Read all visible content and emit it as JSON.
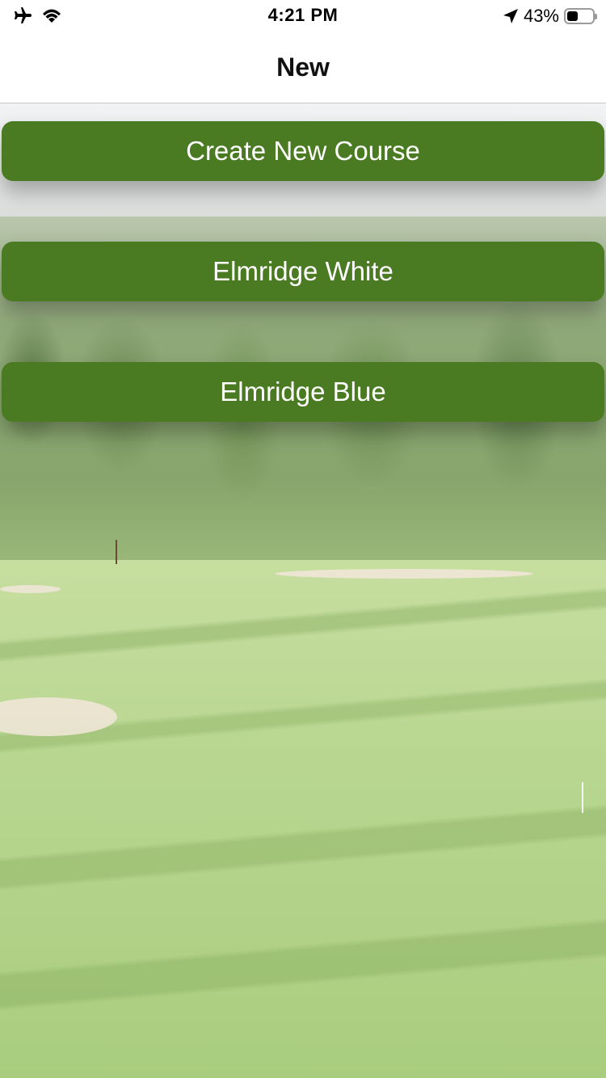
{
  "status_bar": {
    "time": "4:21 PM",
    "battery_percent": "43%",
    "battery_level": 0.43,
    "icons": [
      "airplane-mode-icon",
      "wifi-icon",
      "location-arrow-icon",
      "battery-icon"
    ]
  },
  "nav": {
    "title": "New"
  },
  "buttons": {
    "create_new_course": "Create New Course"
  },
  "courses": [
    {
      "label": "Elmridge White"
    },
    {
      "label": "Elmridge Blue"
    }
  ],
  "colors": {
    "button_green": "#4a7a21",
    "button_text": "#ffffff"
  }
}
